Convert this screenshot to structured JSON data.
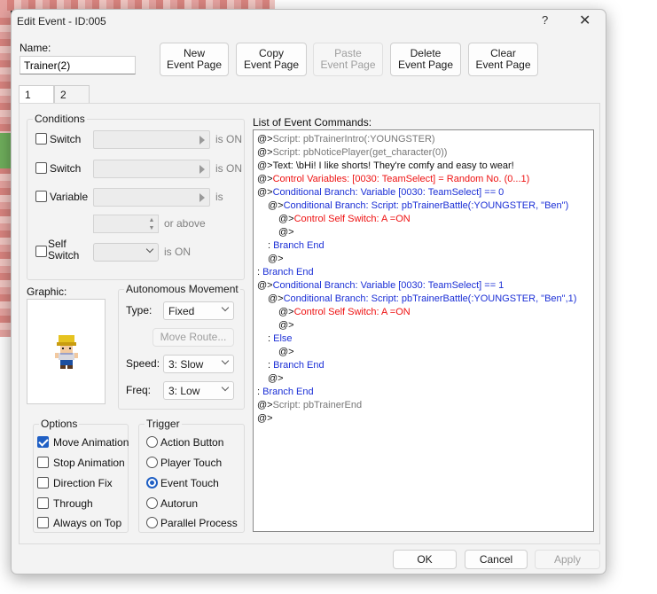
{
  "window": {
    "title": "Edit Event - ID:005",
    "help_glyph": "?",
    "close_glyph": "✕"
  },
  "name": {
    "label": "Name:",
    "value": "Trainer(2)"
  },
  "toolbar": {
    "new_page": [
      "New",
      "Event Page"
    ],
    "copy_page": [
      "Copy",
      "Event Page"
    ],
    "paste_page": [
      "Paste",
      "Event Page"
    ],
    "delete_page": [
      "Delete",
      "Event Page"
    ],
    "clear_page": [
      "Clear",
      "Event Page"
    ]
  },
  "tabs": [
    "1",
    "2"
  ],
  "conditions": {
    "label": "Conditions",
    "switch1": {
      "label": "Switch",
      "suffix": "is ON",
      "checked": false
    },
    "switch2": {
      "label": "Switch",
      "suffix": "is ON",
      "checked": false
    },
    "variable": {
      "label": "Variable",
      "suffix": "is",
      "or_above": "or above",
      "checked": false
    },
    "self_switch": {
      "label_line1": "Self",
      "label_line2": "Switch",
      "suffix": "is ON",
      "checked": false
    }
  },
  "graphic": {
    "label": "Graphic:"
  },
  "autonomous": {
    "label": "Autonomous Movement",
    "type_label": "Type:",
    "type_value": "Fixed",
    "move_route": "Move Route...",
    "speed_label": "Speed:",
    "speed_value": "3: Slow",
    "freq_label": "Freq:",
    "freq_value": "3: Low"
  },
  "options": {
    "label": "Options",
    "items": [
      {
        "label": "Move Animation",
        "checked": true
      },
      {
        "label": "Stop Animation",
        "checked": false
      },
      {
        "label": "Direction Fix",
        "checked": false
      },
      {
        "label": "Through",
        "checked": false
      },
      {
        "label": "Always on Top",
        "checked": false
      }
    ]
  },
  "trigger": {
    "label": "Trigger",
    "items": [
      {
        "label": "Action Button",
        "selected": false
      },
      {
        "label": "Player Touch",
        "selected": false
      },
      {
        "label": "Event Touch",
        "selected": true
      },
      {
        "label": "Autorun",
        "selected": false
      },
      {
        "label": "Parallel Process",
        "selected": false
      }
    ]
  },
  "commands": {
    "label": "List of Event Commands:",
    "lines": [
      {
        "indent": 0,
        "prefix": "@>",
        "text": "Script: pbTrainerIntro(:YOUNGSTER)",
        "color": "grey"
      },
      {
        "indent": 0,
        "prefix": "@>",
        "text": "Script: pbNoticePlayer(get_character(0))",
        "color": "grey"
      },
      {
        "indent": 0,
        "prefix": "@>",
        "text": "Text: \\bHi! I like shorts! They're comfy and easy to wear!",
        "color": "black"
      },
      {
        "indent": 0,
        "prefix": "@>",
        "text": "Control Variables: [0030: TeamSelect] = Random No. (0...1)",
        "color": "red"
      },
      {
        "indent": 0,
        "prefix": "@>",
        "text": "Conditional Branch: Variable [0030: TeamSelect] == 0",
        "color": "blue"
      },
      {
        "indent": 1,
        "prefix": "@>",
        "text": "Conditional Branch: Script: pbTrainerBattle(:YOUNGSTER, \"Ben\")",
        "color": "blue"
      },
      {
        "indent": 2,
        "prefix": "@>",
        "text": "Control Self Switch: A =ON",
        "color": "red"
      },
      {
        "indent": 2,
        "prefix": "@>",
        "text": "",
        "color": "black"
      },
      {
        "indent": 1,
        "prefix": " : ",
        "text": "Branch End",
        "color": "blue"
      },
      {
        "indent": 1,
        "prefix": "@>",
        "text": "",
        "color": "black"
      },
      {
        "indent": 0,
        "prefix": " : ",
        "text": "Branch End",
        "color": "blue"
      },
      {
        "indent": 0,
        "prefix": "@>",
        "text": "Conditional Branch: Variable [0030: TeamSelect] == 1",
        "color": "blue"
      },
      {
        "indent": 1,
        "prefix": "@>",
        "text": "Conditional Branch: Script: pbTrainerBattle(:YOUNGSTER, \"Ben\",1)",
        "color": "blue"
      },
      {
        "indent": 2,
        "prefix": "@>",
        "text": "Control Self Switch: A =ON",
        "color": "red"
      },
      {
        "indent": 2,
        "prefix": "@>",
        "text": "",
        "color": "black"
      },
      {
        "indent": 1,
        "prefix": " : ",
        "text": "Else",
        "color": "blue"
      },
      {
        "indent": 2,
        "prefix": "@>",
        "text": "",
        "color": "black"
      },
      {
        "indent": 1,
        "prefix": " : ",
        "text": "Branch End",
        "color": "blue"
      },
      {
        "indent": 1,
        "prefix": "@>",
        "text": "",
        "color": "black"
      },
      {
        "indent": 0,
        "prefix": " : ",
        "text": "Branch End",
        "color": "blue"
      },
      {
        "indent": 0,
        "prefix": "@>",
        "text": "Script: pbTrainerEnd",
        "color": "grey"
      },
      {
        "indent": 0,
        "prefix": "@>",
        "text": "",
        "color": "black"
      }
    ]
  },
  "footer": {
    "ok": "OK",
    "cancel": "Cancel",
    "apply": "Apply"
  },
  "colors": {
    "accent": "#1f5fc4",
    "cmd_red": "#e11111",
    "cmd_blue": "#1b2fd6",
    "cmd_grey": "#777777"
  }
}
